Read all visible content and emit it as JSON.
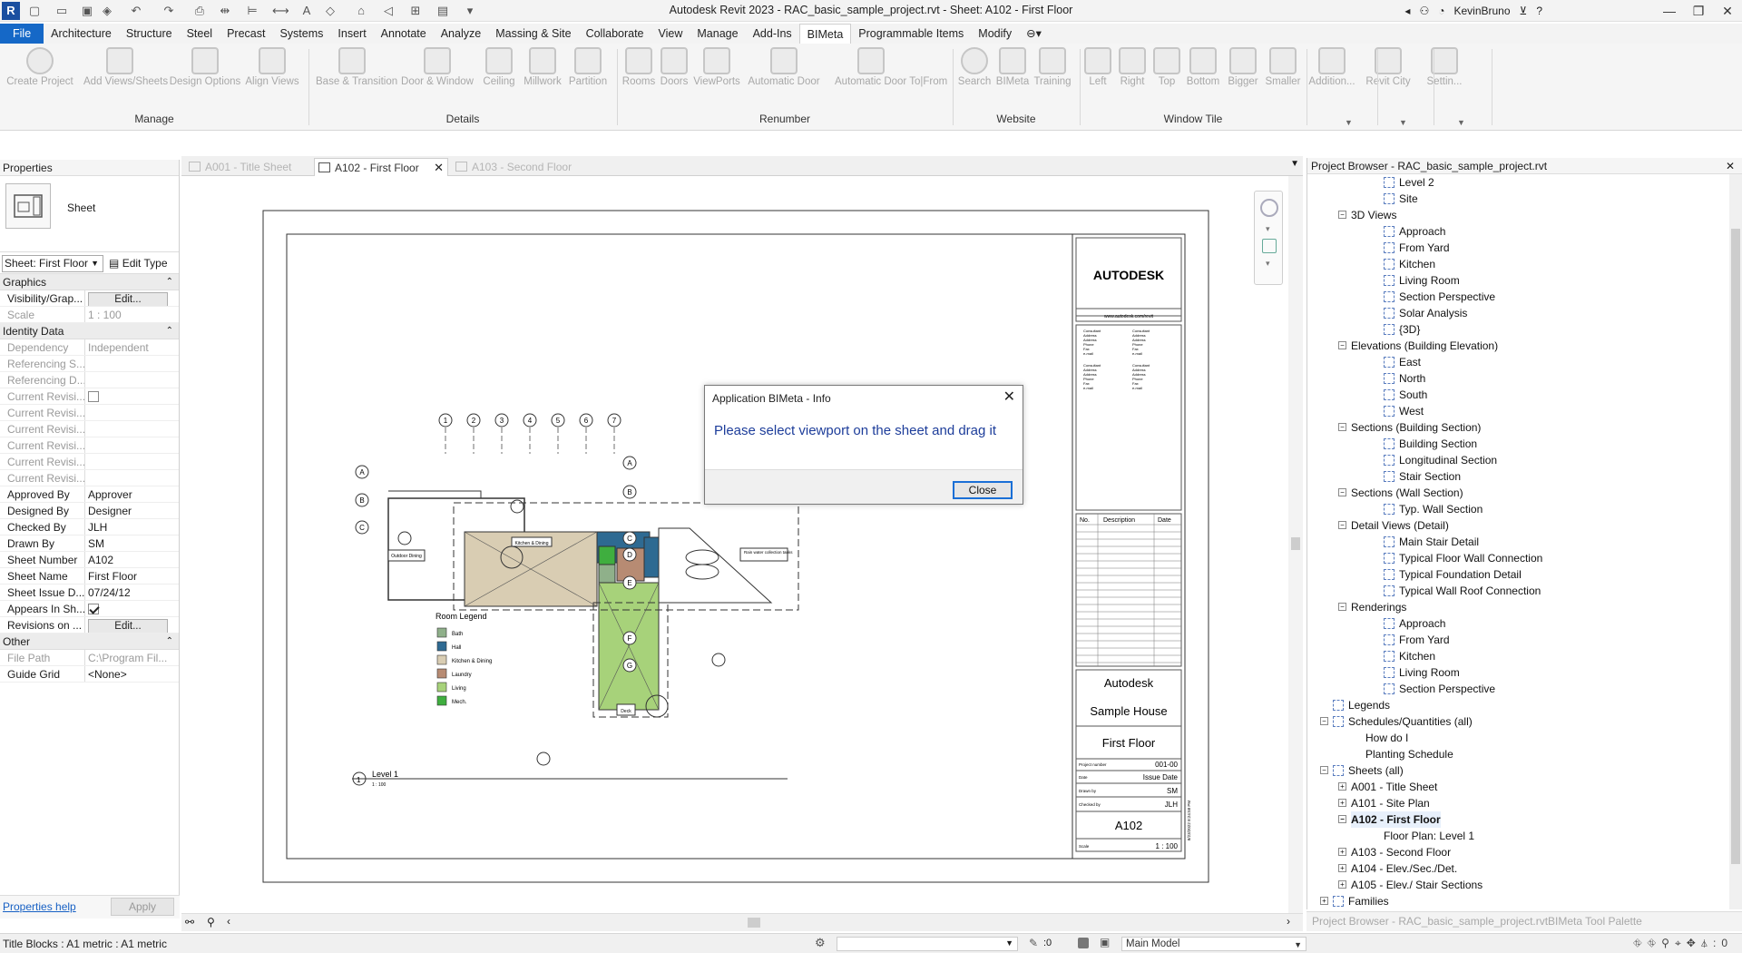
{
  "window": {
    "title": "Autodesk Revit 2023 - RAC_basic_sample_project.rvt - Sheet: A102 - First Floor",
    "user": "KevinBruno",
    "app_letter": "R"
  },
  "tabs": [
    "File",
    "Architecture",
    "Structure",
    "Steel",
    "Precast",
    "Systems",
    "Insert",
    "Annotate",
    "Analyze",
    "Massing & Site",
    "Collaborate",
    "View",
    "Manage",
    "Add-Ins",
    "BIMeta",
    "Programmable Items",
    "Modify"
  ],
  "active_tab": "BIMeta",
  "ribbon": {
    "buttons": [
      "Create Project",
      "Add Views/Sheets",
      "Design Options",
      "Align Views",
      "Base & Transition",
      "Door & Window",
      "Ceiling",
      "Millwork",
      "Partition",
      "Rooms",
      "Doors",
      "ViewPorts",
      "Automatic Door",
      "Automatic Door To|From",
      "Search",
      "BIMeta",
      "Training",
      "Left",
      "Right",
      "Top",
      "Bottom",
      "Bigger",
      "Smaller",
      "Addition...",
      "Revit City",
      "Settin..."
    ],
    "groups": [
      "Manage",
      "Details",
      "Renumber",
      "Website",
      "Window Tile"
    ]
  },
  "properties": {
    "title": "Properties",
    "type_label": "Sheet",
    "selector": "Sheet: First Floor",
    "edit_type": "Edit Type",
    "groups": {
      "graphics": "Graphics",
      "identity": "Identity Data",
      "other": "Other"
    },
    "rows": {
      "vis_label": "Visibility/Grap...",
      "vis_btn": "Edit...",
      "scale_label": "Scale",
      "scale_val": "1 : 100",
      "dep_label": "Dependency",
      "dep_val": "Independent",
      "ref1_label": "Referencing S...",
      "ref2_label": "Referencing D...",
      "cur_label": "Current Revisi...",
      "appr_label": "Approved By",
      "appr_val": "Approver",
      "des_label": "Designed By",
      "des_val": "Designer",
      "chk_label": "Checked By",
      "chk_val": "JLH",
      "drawn_label": "Drawn By",
      "drawn_val": "SM",
      "num_label": "Sheet Number",
      "num_val": "A102",
      "name_label": "Sheet Name",
      "name_val": "First Floor",
      "issue_label": "Sheet Issue D...",
      "issue_val": "07/24/12",
      "appears_label": "Appears In Sh...",
      "rev_label": "Revisions on ...",
      "rev_btn": "Edit...",
      "path_label": "File Path",
      "path_val": "C:\\Program Fil...",
      "grid_label": "Guide Grid",
      "grid_val": "<None>"
    },
    "help": "Properties help",
    "apply": "Apply"
  },
  "doc_tabs": [
    "A001 - Title Sheet",
    "A102 - First Floor",
    "A103 - Second Floor"
  ],
  "sheet": {
    "logo": "AUTODESK",
    "url": "www.autodesk.com/revit",
    "rev_headers": [
      "No.",
      "Description",
      "Date"
    ],
    "company": "Autodesk",
    "project": "Sample House",
    "sheet_name": "First Floor",
    "project_number_label": "Project number",
    "project_number": "001-00",
    "date_label": "Date",
    "date": "Issue Date",
    "drawn_by_label": "Drawn by",
    "drawn_by": "SM",
    "checked_by_label": "Checked by",
    "checked_by": "JLH",
    "sheet_number": "A102",
    "scale_label": "Scale",
    "scale": "1 : 100",
    "side_date": "8/23/2022 8:24:58 PM",
    "consultant_lines": [
      "Consultant",
      "Address",
      "Address",
      "Phone",
      "Fax",
      "e-mail"
    ],
    "level_label": "Level 1",
    "level_scale": "1 : 100",
    "legend_title": "Room Legend",
    "legend": [
      {
        "label": "Bath",
        "color": "#8fb08a"
      },
      {
        "label": "Hall",
        "color": "#2e6a92"
      },
      {
        "label": "Kitchen & Dining",
        "color": "#d9cdb3"
      },
      {
        "label": "Laundry",
        "color": "#b78b73"
      },
      {
        "label": "Living",
        "color": "#a7d27a"
      },
      {
        "label": "Mech.",
        "color": "#3fae3f"
      }
    ],
    "grid_cols": [
      "1",
      "2",
      "3",
      "4",
      "5",
      "6",
      "7"
    ],
    "grid_rows_left": [
      "A",
      "B",
      "C"
    ],
    "grid_rows_right": [
      "A",
      "B",
      "C",
      "D",
      "E",
      "F",
      "G"
    ],
    "room_kitchen": "Kitchen & Dining",
    "room_outdoor": "Outdoor Dining",
    "room_deck": "Deck",
    "note_water": "Rain water collection tanks"
  },
  "dialog": {
    "title": "Application BIMeta - Info",
    "message": "Please select viewport on the sheet and drag it",
    "button": "Close"
  },
  "browser": {
    "title": "Project Browser - RAC_basic_sample_project.rvt",
    "items": [
      {
        "label": "Level 2",
        "level": 2,
        "icon": true
      },
      {
        "label": "Site",
        "level": 2,
        "icon": true
      },
      {
        "label": "3D Views",
        "level": 1,
        "exp": "-"
      },
      {
        "label": "Approach",
        "level": 2,
        "icon": true
      },
      {
        "label": "From Yard",
        "level": 2,
        "icon": true
      },
      {
        "label": "Kitchen",
        "level": 2,
        "icon": true
      },
      {
        "label": "Living Room",
        "level": 2,
        "icon": true
      },
      {
        "label": "Section Perspective",
        "level": 2,
        "icon": true
      },
      {
        "label": "Solar Analysis",
        "level": 2,
        "icon": true
      },
      {
        "label": "{3D}",
        "level": 2,
        "icon": true
      },
      {
        "label": "Elevations (Building Elevation)",
        "level": 1,
        "exp": "-"
      },
      {
        "label": "East",
        "level": 2,
        "icon": true
      },
      {
        "label": "North",
        "level": 2,
        "icon": true
      },
      {
        "label": "South",
        "level": 2,
        "icon": true
      },
      {
        "label": "West",
        "level": 2,
        "icon": true
      },
      {
        "label": "Sections (Building Section)",
        "level": 1,
        "exp": "-"
      },
      {
        "label": "Building Section",
        "level": 2,
        "icon": true
      },
      {
        "label": "Longitudinal Section",
        "level": 2,
        "icon": true
      },
      {
        "label": "Stair Section",
        "level": 2,
        "icon": true
      },
      {
        "label": "Sections (Wall Section)",
        "level": 1,
        "exp": "-"
      },
      {
        "label": "Typ. Wall Section",
        "level": 2,
        "icon": true
      },
      {
        "label": "Detail Views (Detail)",
        "level": 1,
        "exp": "-"
      },
      {
        "label": "Main Stair Detail",
        "level": 2,
        "icon": true
      },
      {
        "label": "Typical Floor Wall Connection",
        "level": 2,
        "icon": true
      },
      {
        "label": "Typical Foundation Detail",
        "level": 2,
        "icon": true
      },
      {
        "label": "Typical Wall Roof Connection",
        "level": 2,
        "icon": true
      },
      {
        "label": "Renderings",
        "level": 1,
        "exp": "-"
      },
      {
        "label": "Approach",
        "level": 2,
        "icon": true
      },
      {
        "label": "From Yard",
        "level": 2,
        "icon": true
      },
      {
        "label": "Kitchen",
        "level": 2,
        "icon": true
      },
      {
        "label": "Living Room",
        "level": 2,
        "icon": true
      },
      {
        "label": "Section Perspective",
        "level": 2,
        "icon": true
      },
      {
        "label": "Legends",
        "level": 0,
        "icon": true
      },
      {
        "label": "Schedules/Quantities (all)",
        "level": 0,
        "exp": "-",
        "icon": true
      },
      {
        "label": "How do I",
        "level": 1,
        "indent": true
      },
      {
        "label": "Planting Schedule",
        "level": 1,
        "indent": true
      },
      {
        "label": "Sheets (all)",
        "level": 0,
        "exp": "-",
        "icon": true
      },
      {
        "label": "A001 - Title Sheet",
        "level": 1,
        "exp": "+"
      },
      {
        "label": "A101 - Site Plan",
        "level": 1,
        "exp": "+"
      },
      {
        "label": "A102 - First Floor",
        "level": 1,
        "exp": "-",
        "selected": true
      },
      {
        "label": "Floor Plan: Level 1",
        "level": 2
      },
      {
        "label": "A103 - Second Floor",
        "level": 1,
        "exp": "+"
      },
      {
        "label": "A104 - Elev./Sec./Det.",
        "level": 1,
        "exp": "+"
      },
      {
        "label": "A105 - Elev./ Stair Sections",
        "level": 1,
        "exp": "+"
      },
      {
        "label": "Families",
        "level": 0,
        "exp": "+",
        "icon": true
      }
    ],
    "bottom_tabs": [
      "Project Browser - RAC_basic_sample_project.rvt",
      "BIMeta Tool Palette"
    ]
  },
  "status": {
    "text": "Title Blocks : A1 metric : A1 metric",
    "zero": ":0",
    "model": "Main Model",
    "filter": ":0"
  }
}
